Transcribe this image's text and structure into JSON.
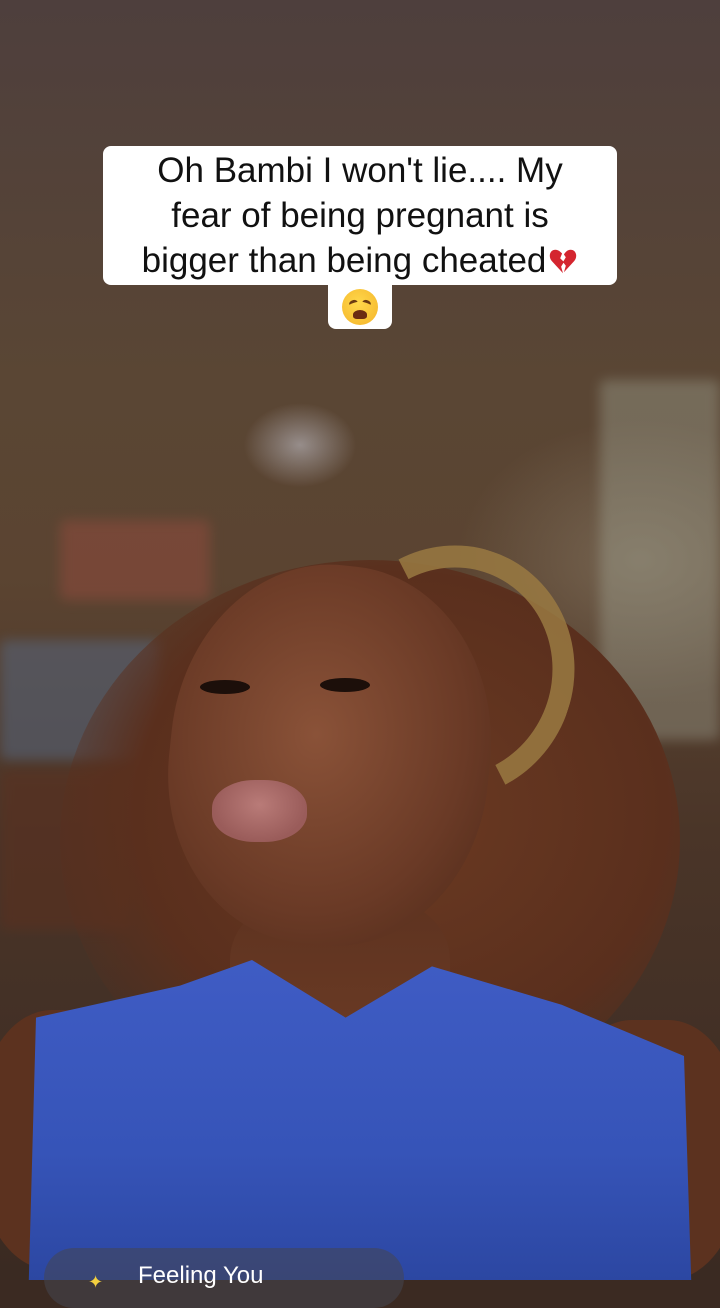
{
  "caption": {
    "text": "Oh Bambi I won't lie.... My\nfear of being pregnant is\nbigger than being cheated",
    "trailing_emoji": "broken-heart",
    "second_line_emoji": "weary-face"
  },
  "music": {
    "icon": "sparkle-icon",
    "title": "Feeling You"
  },
  "colors": {
    "caption_bg": "#ffffff",
    "caption_text": "#111111",
    "shirt": "#3654b8"
  }
}
